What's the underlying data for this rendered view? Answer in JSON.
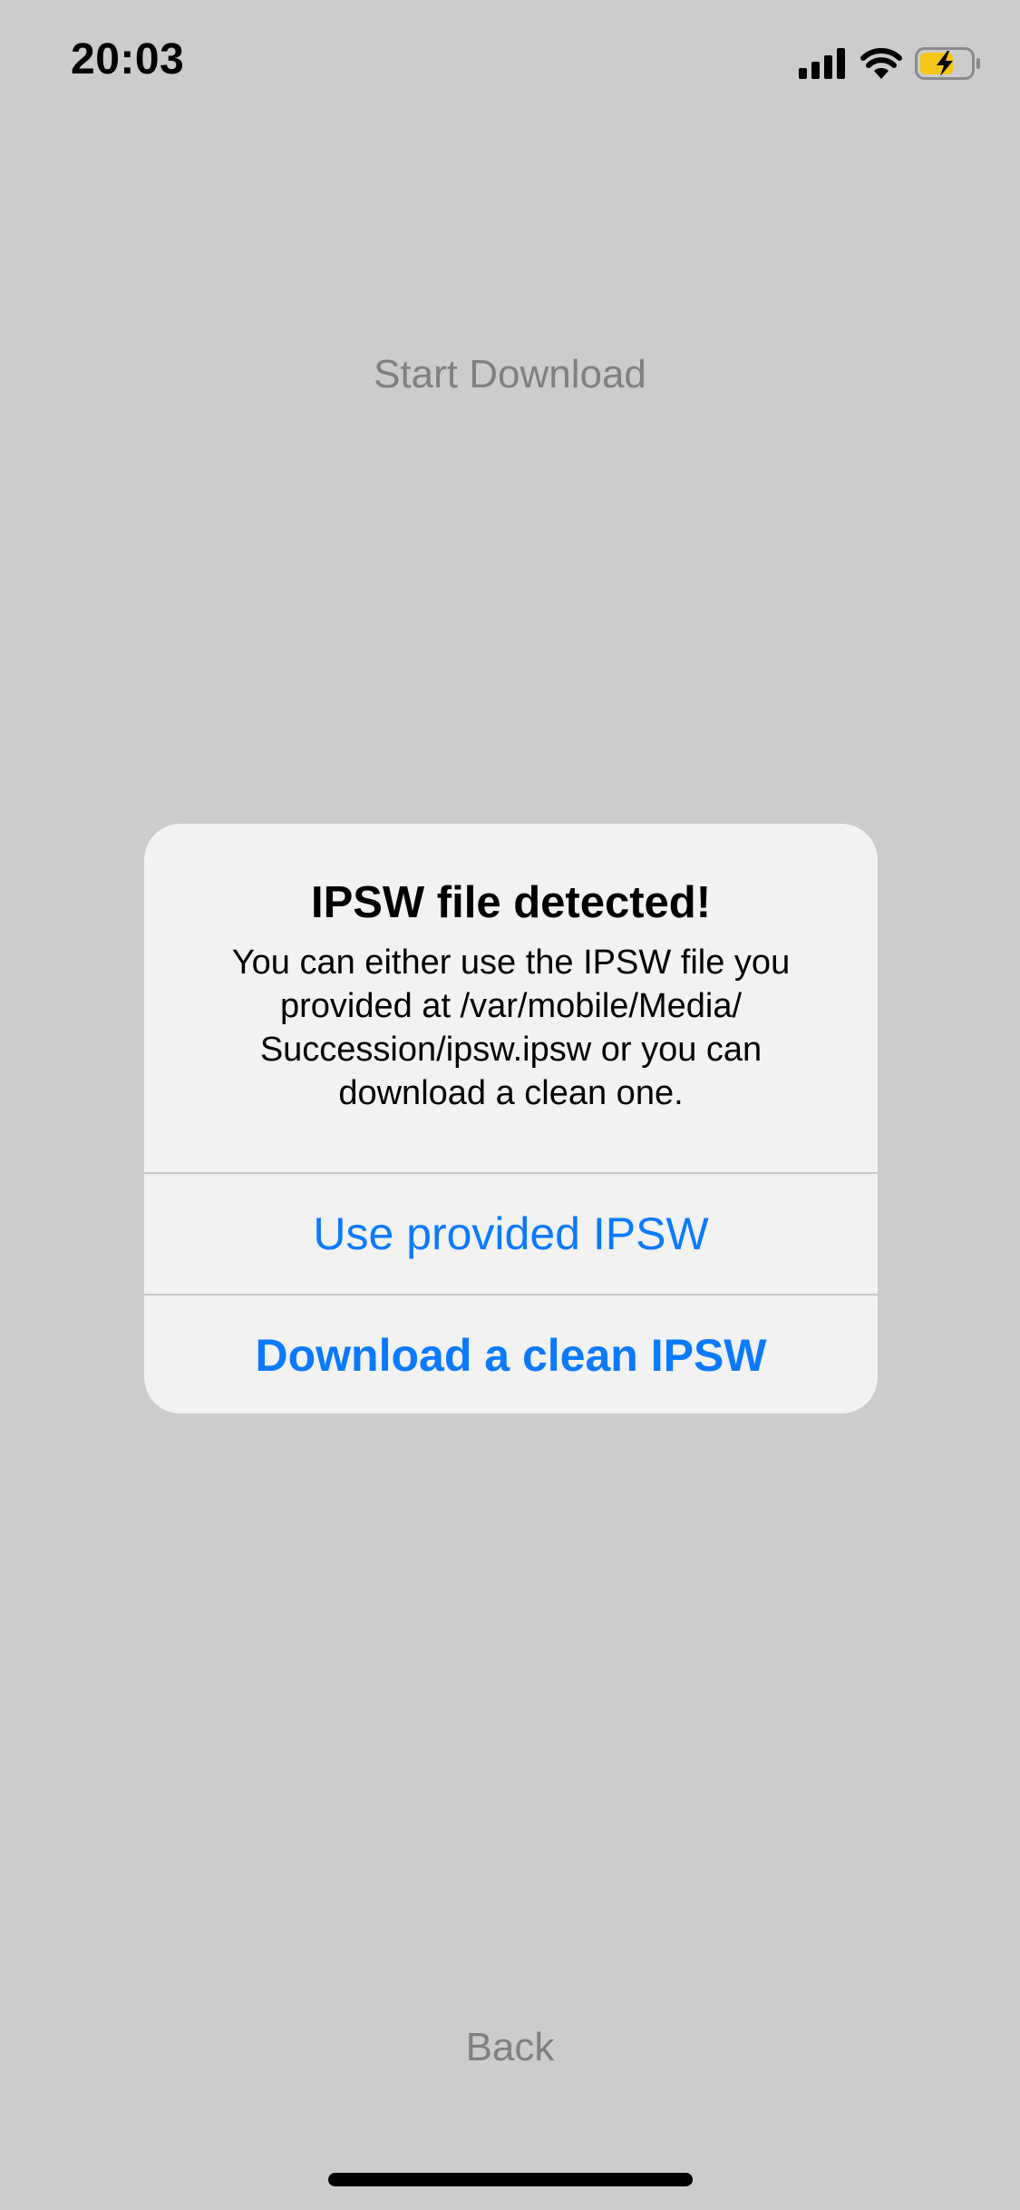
{
  "status_bar": {
    "time": "20:03",
    "icons": [
      "cellular-signal-icon",
      "wifi-icon",
      "battery-charging-icon"
    ],
    "battery_fill_color": "#f5c518"
  },
  "screen": {
    "start_download_label": "Start Download",
    "back_label": "Back"
  },
  "alert": {
    "title": "IPSW file detected!",
    "message_lines": [
      "You can either use the IPSW file you",
      "provided at /var/mobile/Media/",
      "Succession/ipsw.ipsw or you can",
      "download a clean one."
    ],
    "actions": {
      "use_provided": "Use provided IPSW",
      "download_clean": "Download a clean IPSW"
    },
    "action_color": "#0a7aff"
  }
}
